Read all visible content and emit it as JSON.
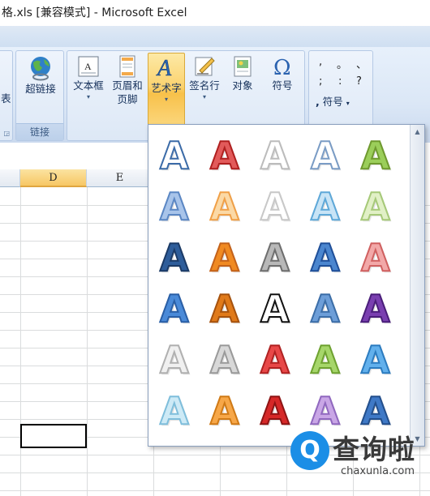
{
  "window": {
    "title": "格.xls  [兼容模式] - Microsoft Excel"
  },
  "ribbon": {
    "left_cut_label": "表",
    "link_group": {
      "label": "链接",
      "button": "超链接"
    },
    "text_group": {
      "buttons": [
        {
          "label": "文本框",
          "icon": "textbox-icon",
          "dropdown": true
        },
        {
          "label": "页眉和",
          "label2": "页脚",
          "icon": "header-footer-icon",
          "dropdown": false
        },
        {
          "label": "艺术字",
          "icon": "wordart-icon",
          "dropdown": true,
          "active": true
        },
        {
          "label": "签名行",
          "icon": "signature-line-icon",
          "dropdown": true
        },
        {
          "label": "对象",
          "icon": "object-icon",
          "dropdown": false
        },
        {
          "label": "符号",
          "icon": "omega-icon",
          "dropdown": false
        }
      ]
    },
    "special_symbols": {
      "row1": [
        ",",
        "。",
        "、"
      ],
      "row2": [
        ";",
        ":",
        "?"
      ],
      "button": "符号"
    }
  },
  "sheet": {
    "columns": [
      "D",
      "E"
    ],
    "selected_column": "D"
  },
  "wordart_gallery": {
    "glyph": "A",
    "styles": [
      [
        "#ffffff",
        "#3b6ba8"
      ],
      [
        "#e25a5a",
        "#b02020"
      ],
      [
        "#ffffff",
        "#bcbcbc"
      ],
      [
        "#ffffff",
        "#7a9cc5"
      ],
      [
        "#9bce5a",
        "#6f9a2f"
      ],
      [
        "#a8c4ea",
        "#5b87c4"
      ],
      [
        "#fbd9a6",
        "#f0a048"
      ],
      [
        "#ffffff",
        "#c8c8c8"
      ],
      [
        "#c8e4f6",
        "#5ea8d8"
      ],
      [
        "#e1f0c6",
        "#a6c978"
      ],
      [
        "#2e5d9a",
        "#1b3a66"
      ],
      [
        "#f08a22",
        "#c4621a"
      ],
      [
        "#b8b8b8",
        "#6e6e6e"
      ],
      [
        "#4b86cf",
        "#1f4f99"
      ],
      [
        "#f2a8a8",
        "#d06060"
      ],
      [
        "#4a8ad8",
        "#2a5fa6"
      ],
      [
        "#e07a1a",
        "#a6520e"
      ],
      [
        "#ffffff",
        "#111111"
      ],
      [
        "#6d9ed8",
        "#3c6ea8"
      ],
      [
        "#7a3fb0",
        "#4a1e7a"
      ],
      [
        "#f0f0f0",
        "#b0b0b0"
      ],
      [
        "#d8d8d8",
        "#9a9a9a"
      ],
      [
        "#e84848",
        "#b02222"
      ],
      [
        "#a6d66a",
        "#6ea230"
      ],
      [
        "#62b0ec",
        "#2c7cc0"
      ],
      [
        "#cdeaf6",
        "#7fbedb"
      ],
      [
        "#f7a748",
        "#d07a16"
      ],
      [
        "#d62828",
        "#8e1414"
      ],
      [
        "#c9a6e6",
        "#9068bf"
      ],
      [
        "#3f79c6",
        "#234f8c"
      ]
    ]
  },
  "watermark": {
    "badge": "Q",
    "title": "查询啦",
    "domain": "chaxunla.com"
  }
}
